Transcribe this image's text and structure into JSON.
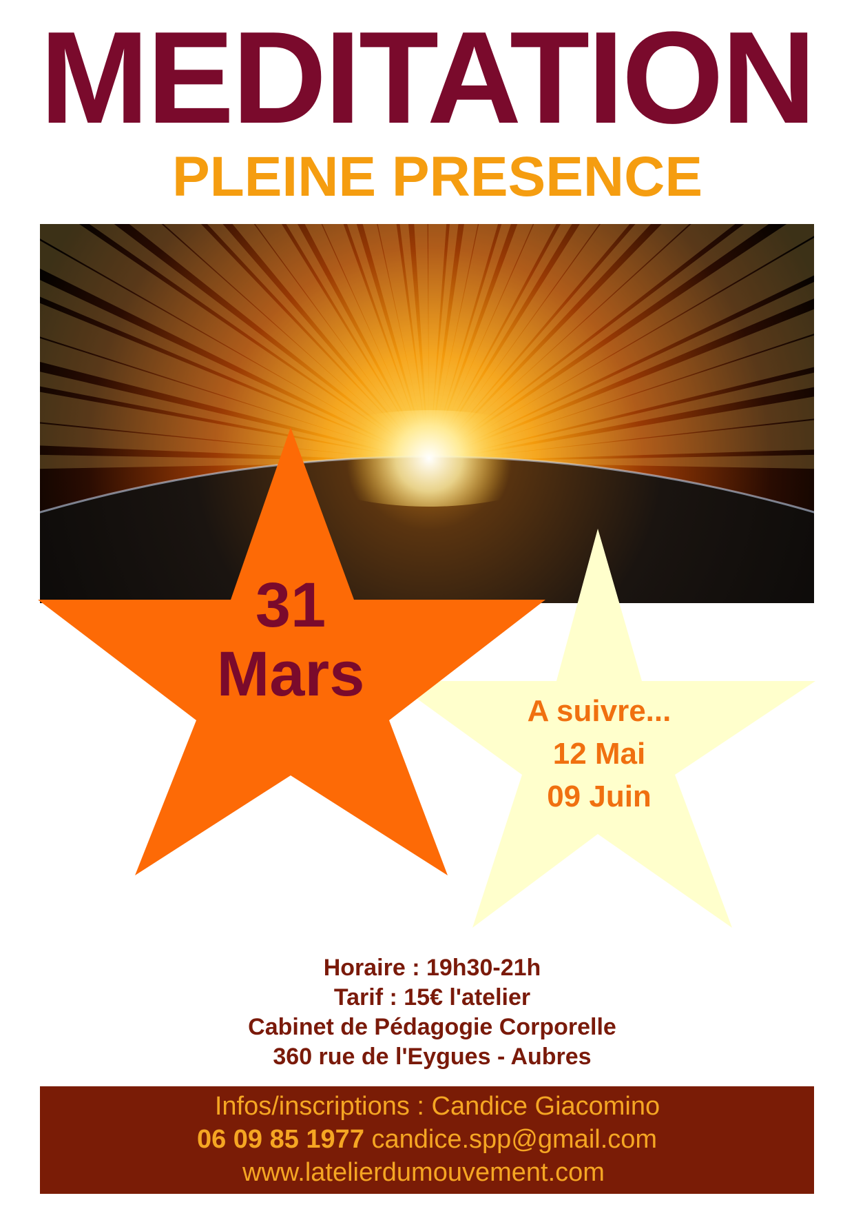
{
  "title": "MEDITATION",
  "subtitle": "PLEINE PRESENCE",
  "image": {
    "description": "sunrise-over-earth"
  },
  "star_main": {
    "day": "31",
    "month": "Mars",
    "color": "#fd6a06"
  },
  "star_secondary": {
    "lines": [
      "A suivre...",
      "12 Mai",
      "09 Juin"
    ],
    "color": "#ffffcc"
  },
  "info": {
    "horaire": "Horaire : 19h30-21h",
    "tarif": "Tarif : 15€ l'atelier",
    "cabinet": "Cabinet de Pédagogie Corporelle",
    "adresse": "360 rue de l'Eygues - Aubres"
  },
  "footer": {
    "contact": "Infos/inscriptions : Candice Giacomino",
    "phone": "06 09 85 1977",
    "email": "candice.spp@gmail.com",
    "website": "www.latelierdumouvement.com"
  },
  "colors": {
    "title": "#7a0a2c",
    "subtitle": "#f59d10",
    "info_text": "#7a1a0a",
    "footer_bg": "#7a1c06",
    "footer_text": "#f5a623"
  }
}
